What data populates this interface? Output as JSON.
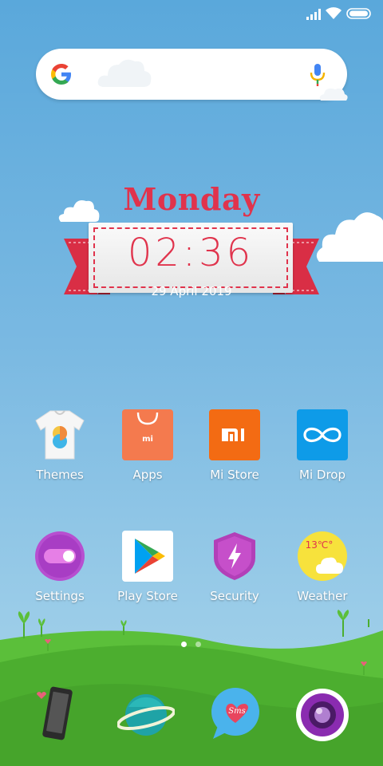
{
  "status_bar": {
    "icons": [
      "signal-icon",
      "wifi-icon",
      "battery-icon"
    ]
  },
  "search": {
    "logo": "google-g-icon",
    "mic": "mic-icon"
  },
  "clock_widget": {
    "day": "Monday",
    "time": "02:36",
    "date": "29 April 2019",
    "accent_color": "#e0334c"
  },
  "apps": {
    "row1": [
      {
        "label": "Themes",
        "icon": "tshirt-icon"
      },
      {
        "label": "Apps",
        "icon": "shopping-bag-icon"
      },
      {
        "label": "Mi Store",
        "icon": "mi-logo-icon"
      },
      {
        "label": "Mi Drop",
        "icon": "infinity-icon"
      }
    ],
    "row2": [
      {
        "label": "Settings",
        "icon": "toggle-icon"
      },
      {
        "label": "Play Store",
        "icon": "play-triangle-icon"
      },
      {
        "label": "Security",
        "icon": "shield-bolt-icon"
      },
      {
        "label": "Weather",
        "icon": "sun-cloud-icon",
        "temperature": "13℃°"
      }
    ]
  },
  "pages": {
    "count": 2,
    "active": 1
  },
  "dock": [
    {
      "icon": "phone-icon"
    },
    {
      "icon": "planet-icon"
    },
    {
      "icon": "sms-bubble-icon",
      "badge": "Sms"
    },
    {
      "icon": "camera-lens-icon"
    }
  ]
}
